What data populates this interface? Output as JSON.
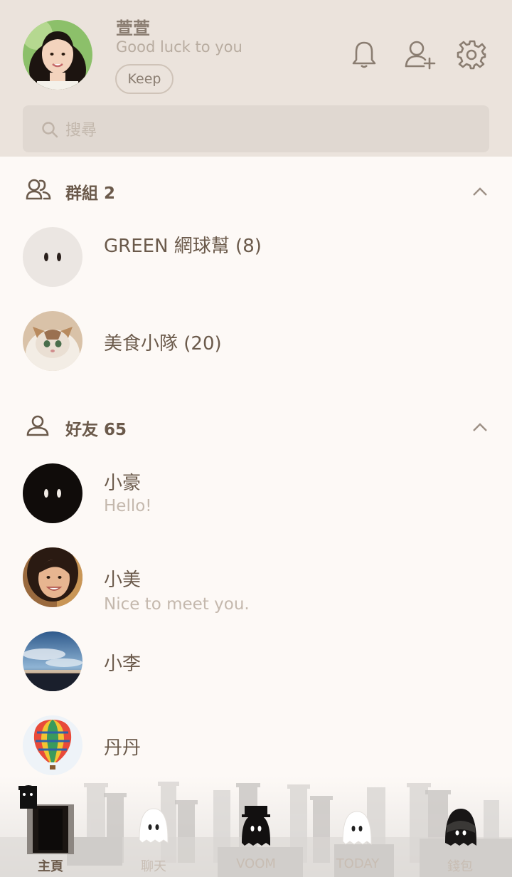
{
  "profile": {
    "name": "萱萱",
    "status": "Good luck to you",
    "keep_label": "Keep"
  },
  "header_icons": [
    "bell-icon",
    "add-friend-icon",
    "settings-icon"
  ],
  "search": {
    "placeholder": "搜尋"
  },
  "groups": {
    "title": "群組 2",
    "items": [
      {
        "name": "GREEN 網球幫 (8)"
      },
      {
        "name": "美食小隊 (20)"
      }
    ]
  },
  "friends": {
    "title": "好友 65",
    "items": [
      {
        "name": "小豪",
        "status": "Hello!"
      },
      {
        "name": "小美",
        "status": "Nice to meet you."
      },
      {
        "name": "小李"
      },
      {
        "name": "丹丹"
      }
    ]
  },
  "nav": {
    "items": [
      {
        "label": "主頁",
        "active": true
      },
      {
        "label": "聊天"
      },
      {
        "label": "VOOM"
      },
      {
        "label": "TODAY"
      },
      {
        "label": "錢包"
      }
    ]
  },
  "colors": {
    "header_bg": "#ebe3dc",
    "body_bg": "#fdf9f6",
    "text": "#6b5a4b",
    "muted": "#c4b8ad"
  }
}
